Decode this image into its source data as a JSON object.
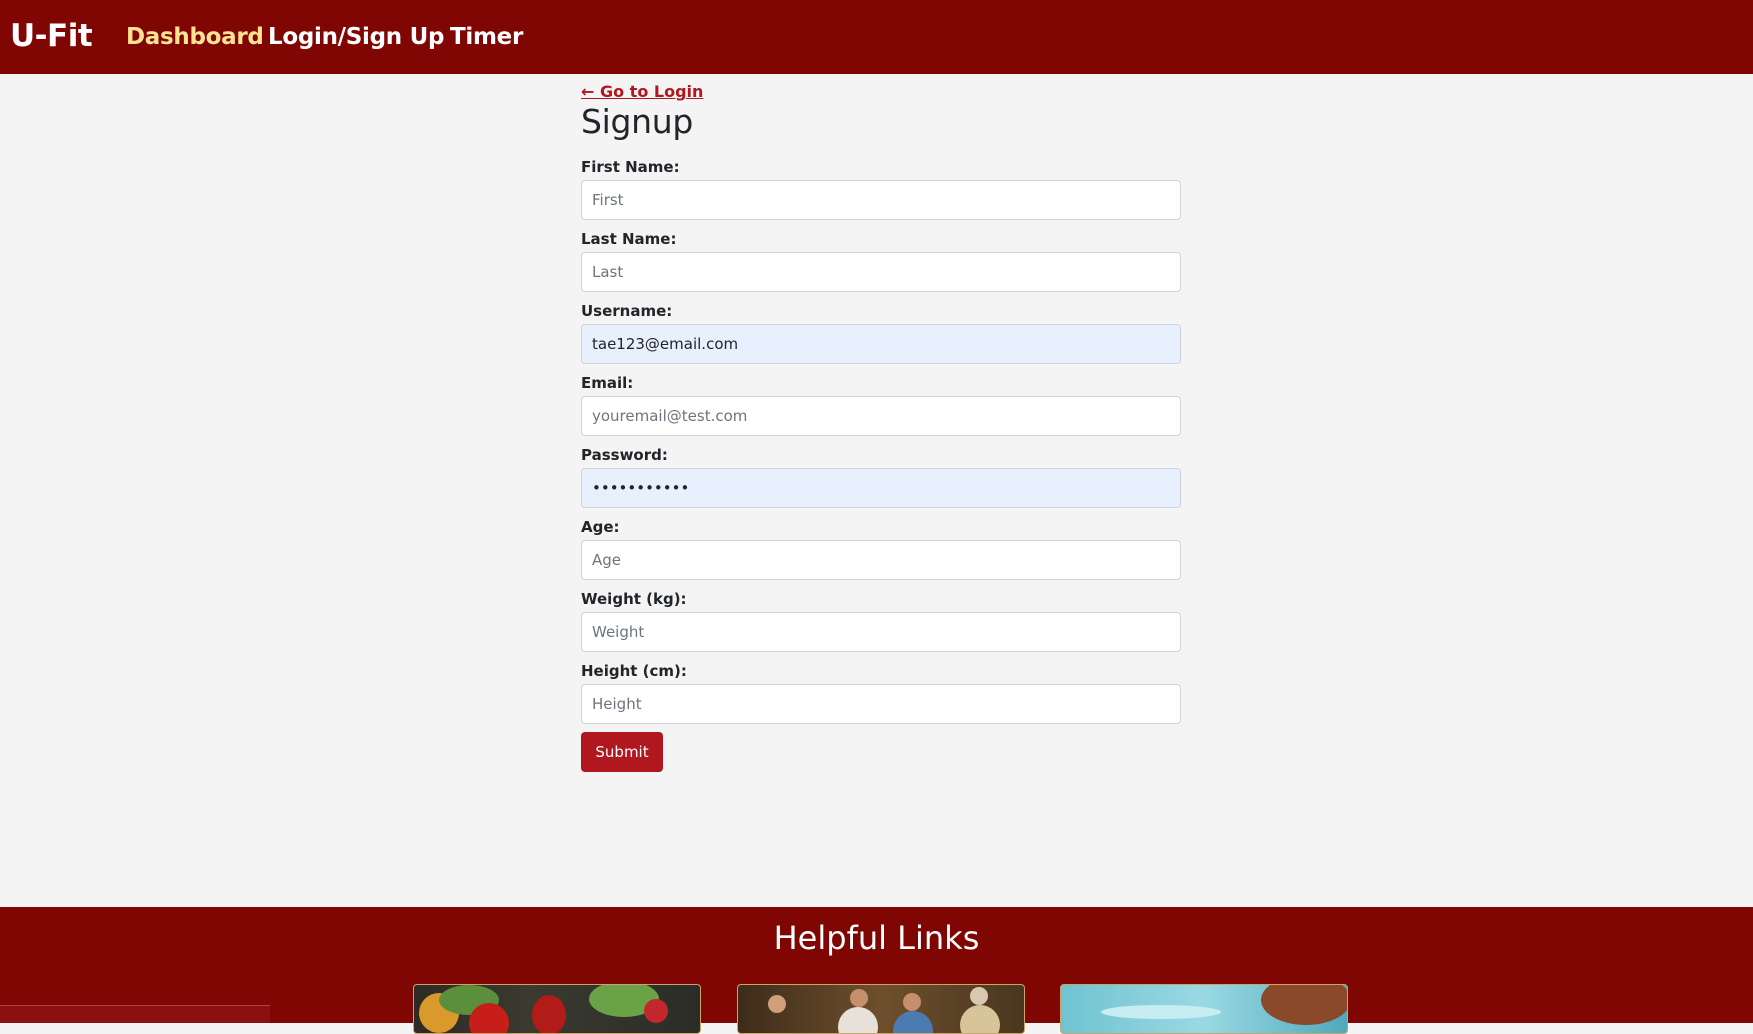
{
  "nav": {
    "brand": "U-Fit",
    "links": [
      {
        "label": "Dashboard",
        "active": true
      },
      {
        "label": "Login/Sign Up",
        "active": false
      },
      {
        "label": "Timer",
        "active": false
      }
    ]
  },
  "form": {
    "back_link": "← Go to Login",
    "title": "Signup",
    "fields": [
      {
        "label": "First Name:",
        "placeholder": "First",
        "value": ""
      },
      {
        "label": "Last Name:",
        "placeholder": "Last",
        "value": ""
      },
      {
        "label": "Username:",
        "placeholder": "",
        "value": "tae123@email.com"
      },
      {
        "label": "Email:",
        "placeholder": "youremail@test.com",
        "value": ""
      },
      {
        "label": "Password:",
        "placeholder": "",
        "value": "•••••••••••"
      },
      {
        "label": "Age:",
        "placeholder": "Age",
        "value": ""
      },
      {
        "label": "Weight (kg):",
        "placeholder": "Weight",
        "value": ""
      },
      {
        "label": "Height (cm):",
        "placeholder": "Height",
        "value": ""
      }
    ],
    "submit_label": "Submit"
  },
  "footer": {
    "title": "Helpful Links",
    "cards": [
      {
        "name": "nutrition-image"
      },
      {
        "name": "running-group-image"
      },
      {
        "name": "swimming-image"
      }
    ]
  },
  "status_bar": {
    "text": ""
  },
  "colors": {
    "navbar": "#800604",
    "active_link": "#ffe393",
    "accent": "#b0171e",
    "autofill_bg": "#e8f0fe"
  }
}
